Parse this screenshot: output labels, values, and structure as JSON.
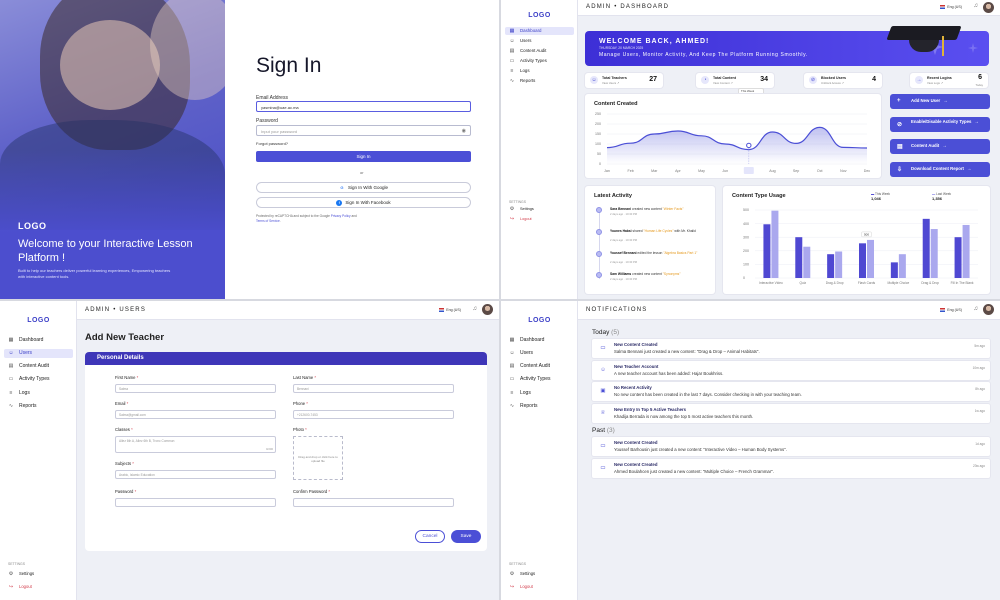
{
  "signin": {
    "hero_logo": "LOGO",
    "hero_title": "Welcome to your Interactive Lesson Platform !",
    "hero_sub": "Built to help our teachers deliver powerful learning experiences, Empowering teachers with interactive content tools.",
    "title": "Sign In",
    "email_label": "Email Address",
    "email_value": "yasmina@uae.ac.ma",
    "password_label": "Password",
    "password_placeholder": "Input your password",
    "forgot": "Forgot password?",
    "signin_button": "Sign In",
    "or": "or",
    "google_button": "Sign In With Google",
    "facebook_button": "Sign In With Facebook",
    "terms_pre": "Protected by reCAPTCHA and subject to the Google ",
    "terms_privacy": "Privacy Policy",
    "terms_and": " and ",
    "terms_tos": "Terms of Service",
    "terms_post": "."
  },
  "dashboard": {
    "logo": "LOGO",
    "topbar_title": "ADMIN • DASHBOARD",
    "lang": "Eng (US)",
    "nav": [
      "Dashboard",
      "Users",
      "Content Audit",
      "Activity Types",
      "Logs",
      "Reports"
    ],
    "settings_title": "SETTINGS",
    "settings": "Settings",
    "logout": "Logout",
    "banner_welcome": "WELCOME BACK, AHMED!",
    "banner_date": "THURSDAY, 20 MARCH 2025",
    "banner_sub": "Manage Users, Monitor Activity, And Keep The Platform Running Smoothly.",
    "stats": [
      {
        "label": "Total Teachers",
        "sub": "View Users ↗",
        "value": "27"
      },
      {
        "label": "Total Content",
        "sub": "View Content ↗",
        "value": "34"
      },
      {
        "label": "Blocked Users",
        "sub": "Unblock Access ↗",
        "value": "4"
      },
      {
        "label": "Recent Logins",
        "sub": "View Logs ↗",
        "value": "6"
      }
    ],
    "recent_logins_sub2": "Today",
    "filter": [
      "This Week",
      "This Month",
      "This Year",
      "This Year"
    ],
    "content_created_title": "Content Created",
    "quick_actions": [
      "Add New User",
      "Enable/Disable Activity Types",
      "Content Audit",
      "Download Content Report"
    ],
    "latest_activity_title": "Latest Activity",
    "activity": [
      {
        "who": "Sara Bennani",
        "text": " created new content ",
        "hl": "\"Winter Facts\"",
        "time": "2 days ago · 10:30 PM"
      },
      {
        "who": "Younes Habsi",
        "text": " shared ",
        "hl": "\"Human Life Cycles\"",
        "tail": " with Mr. Khalid",
        "time": "2 days ago · 10:30 PM"
      },
      {
        "who": "Youssef Bennani",
        "text": " edited the lesson ",
        "hl": "\"Algebra Basics Part 1\"",
        "time": "2 days ago · 10:30 PM"
      },
      {
        "who": "Sam Williams",
        "text": " created new content ",
        "hl": "\"Synonyms\"",
        "time": "2 days ago · 10:30 PM"
      }
    ],
    "content_type_title": "Content Type Usage",
    "legend_a_label": "This Week",
    "legend_a_value": "1,046",
    "legend_b_label": "Last Week",
    "legend_b_value": "1,356",
    "tooltip_value": "500"
  },
  "chart_data": [
    {
      "type": "area",
      "title": "Content Created",
      "categories": [
        "Jan",
        "Feb",
        "Mar",
        "Apr",
        "May",
        "Jun",
        "Jul",
        "Aug",
        "Sep",
        "Oct",
        "Nov",
        "Dec"
      ],
      "yticks": [
        "0",
        "50",
        "100",
        "150",
        "200",
        "250"
      ],
      "values": [
        82,
        104,
        150,
        165,
        141,
        100,
        72,
        160,
        103,
        183,
        83,
        80
      ],
      "ylim": [
        0,
        250
      ],
      "highlight": {
        "category": "Jul",
        "value": 93
      }
    },
    {
      "type": "bar",
      "title": "Content Type Usage",
      "categories": [
        "Interactive Video",
        "Quiz",
        "Drag & Drop",
        "Flash Cards",
        "Multiple Choice",
        "Drag & Drop",
        "Fill In The Blank"
      ],
      "yticks": [
        "0",
        "100",
        "200",
        "300",
        "400",
        "500"
      ],
      "ylim": [
        0,
        500
      ],
      "series": [
        {
          "name": "This Week",
          "values": [
            395,
            300,
            175,
            255,
            115,
            435,
            300
          ]
        },
        {
          "name": "Last Week",
          "values": [
            495,
            230,
            195,
            280,
            175,
            360,
            390
          ]
        }
      ]
    }
  ],
  "addteacher": {
    "logo": "LOGO",
    "topbar_title": "ADMIN • USERS",
    "lang": "Eng (US)",
    "nav": [
      "Dashboard",
      "Users",
      "Content Audit",
      "Activity Types",
      "Logs",
      "Reports"
    ],
    "settings_title": "SETTINGS",
    "settings": "Settings",
    "logout": "Logout",
    "page_title": "Add New Teacher",
    "section": "Personal Details",
    "first_name": "First Name",
    "first_name_ph": "Salma",
    "last_name": "Last Name",
    "last_name_ph": "Bennani",
    "email": "Email",
    "email_ph": "Salma@gmail.com",
    "phone": "Phone",
    "phone_ph": "+212600-7453",
    "classes": "Classes",
    "classes_ph": "Allez 6th A, Allez 6th B, Tronc Commun",
    "classes_count": "0/200",
    "photo": "Photo",
    "photo_hint": "Drag and drop or click here to upload file",
    "subjects": "Subjects",
    "subjects_ph": "Arabic, Islamic Education",
    "password": "Password",
    "confirm_password": "Confirm Password",
    "required": "*",
    "cancel": "Cancel",
    "save": "Save"
  },
  "notifications": {
    "logo": "LOGO",
    "topbar_title": "NOTIFICATIONS",
    "lang": "Eng (US)",
    "nav": [
      "Dashboard",
      "Users",
      "Content Audit",
      "Activity Types",
      "Logs",
      "Reports"
    ],
    "settings_title": "SETTINGS",
    "settings": "Settings",
    "logout": "Logout",
    "today": "Today",
    "today_count": "(5)",
    "past": "Past",
    "past_count": "(3)",
    "today_items": [
      {
        "icon": "content-icon",
        "title": "New Content Created",
        "body": "Salma Bennani just created a new content: \"Drag & Drop – Animal Habitats\".",
        "ago": "5m ago"
      },
      {
        "icon": "user-icon",
        "title": "New Teacher Account",
        "body": "A new teacher account has been added: Hajar Boukhriss.",
        "ago": "10m ago"
      },
      {
        "icon": "calendar-icon",
        "title": "No Recent Activity",
        "body": "No new content has been created in the last 7 days. Consider checking in with your teaching team.",
        "ago": "8h ago"
      },
      {
        "icon": "trophy-icon",
        "title": "New Entry In Top 5 Active Teachers",
        "body": "Khadija Berrada is now among the top 5 most active teachers this month.",
        "ago": "1w ago"
      }
    ],
    "past_items": [
      {
        "icon": "content-icon",
        "title": "New Content Created",
        "body": "Youssef Barhousin just created a new content: \"Interactive Video – Human Body Systems\".",
        "ago": "1d ago"
      },
      {
        "icon": "content-icon",
        "title": "New Content Created",
        "body": "Ahmed Boulahcen just created a new content: \"Multiple Choice – French Grammar\".",
        "ago": "23w ago"
      }
    ]
  }
}
